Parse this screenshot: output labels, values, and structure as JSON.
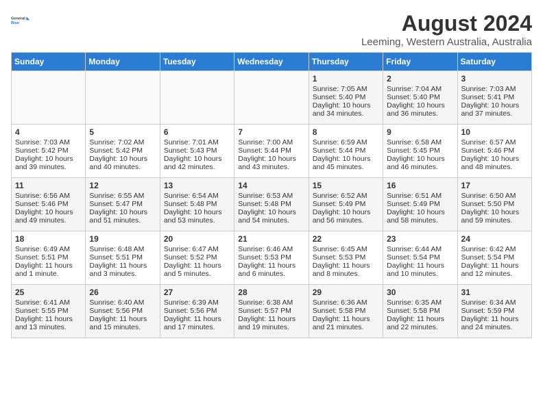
{
  "header": {
    "logo_line1": "General",
    "logo_line2": "Blue",
    "month_year": "August 2024",
    "location": "Leeming, Western Australia, Australia"
  },
  "days_of_week": [
    "Sunday",
    "Monday",
    "Tuesday",
    "Wednesday",
    "Thursday",
    "Friday",
    "Saturday"
  ],
  "weeks": [
    [
      {
        "day": "",
        "info": ""
      },
      {
        "day": "",
        "info": ""
      },
      {
        "day": "",
        "info": ""
      },
      {
        "day": "",
        "info": ""
      },
      {
        "day": "1",
        "info": "Sunrise: 7:05 AM\nSunset: 5:40 PM\nDaylight: 10 hours\nand 34 minutes."
      },
      {
        "day": "2",
        "info": "Sunrise: 7:04 AM\nSunset: 5:40 PM\nDaylight: 10 hours\nand 36 minutes."
      },
      {
        "day": "3",
        "info": "Sunrise: 7:03 AM\nSunset: 5:41 PM\nDaylight: 10 hours\nand 37 minutes."
      }
    ],
    [
      {
        "day": "4",
        "info": "Sunrise: 7:03 AM\nSunset: 5:42 PM\nDaylight: 10 hours\nand 39 minutes."
      },
      {
        "day": "5",
        "info": "Sunrise: 7:02 AM\nSunset: 5:42 PM\nDaylight: 10 hours\nand 40 minutes."
      },
      {
        "day": "6",
        "info": "Sunrise: 7:01 AM\nSunset: 5:43 PM\nDaylight: 10 hours\nand 42 minutes."
      },
      {
        "day": "7",
        "info": "Sunrise: 7:00 AM\nSunset: 5:44 PM\nDaylight: 10 hours\nand 43 minutes."
      },
      {
        "day": "8",
        "info": "Sunrise: 6:59 AM\nSunset: 5:44 PM\nDaylight: 10 hours\nand 45 minutes."
      },
      {
        "day": "9",
        "info": "Sunrise: 6:58 AM\nSunset: 5:45 PM\nDaylight: 10 hours\nand 46 minutes."
      },
      {
        "day": "10",
        "info": "Sunrise: 6:57 AM\nSunset: 5:46 PM\nDaylight: 10 hours\nand 48 minutes."
      }
    ],
    [
      {
        "day": "11",
        "info": "Sunrise: 6:56 AM\nSunset: 5:46 PM\nDaylight: 10 hours\nand 49 minutes."
      },
      {
        "day": "12",
        "info": "Sunrise: 6:55 AM\nSunset: 5:47 PM\nDaylight: 10 hours\nand 51 minutes."
      },
      {
        "day": "13",
        "info": "Sunrise: 6:54 AM\nSunset: 5:48 PM\nDaylight: 10 hours\nand 53 minutes."
      },
      {
        "day": "14",
        "info": "Sunrise: 6:53 AM\nSunset: 5:48 PM\nDaylight: 10 hours\nand 54 minutes."
      },
      {
        "day": "15",
        "info": "Sunrise: 6:52 AM\nSunset: 5:49 PM\nDaylight: 10 hours\nand 56 minutes."
      },
      {
        "day": "16",
        "info": "Sunrise: 6:51 AM\nSunset: 5:49 PM\nDaylight: 10 hours\nand 58 minutes."
      },
      {
        "day": "17",
        "info": "Sunrise: 6:50 AM\nSunset: 5:50 PM\nDaylight: 10 hours\nand 59 minutes."
      }
    ],
    [
      {
        "day": "18",
        "info": "Sunrise: 6:49 AM\nSunset: 5:51 PM\nDaylight: 11 hours\nand 1 minute."
      },
      {
        "day": "19",
        "info": "Sunrise: 6:48 AM\nSunset: 5:51 PM\nDaylight: 11 hours\nand 3 minutes."
      },
      {
        "day": "20",
        "info": "Sunrise: 6:47 AM\nSunset: 5:52 PM\nDaylight: 11 hours\nand 5 minutes."
      },
      {
        "day": "21",
        "info": "Sunrise: 6:46 AM\nSunset: 5:53 PM\nDaylight: 11 hours\nand 6 minutes."
      },
      {
        "day": "22",
        "info": "Sunrise: 6:45 AM\nSunset: 5:53 PM\nDaylight: 11 hours\nand 8 minutes."
      },
      {
        "day": "23",
        "info": "Sunrise: 6:44 AM\nSunset: 5:54 PM\nDaylight: 11 hours\nand 10 minutes."
      },
      {
        "day": "24",
        "info": "Sunrise: 6:42 AM\nSunset: 5:54 PM\nDaylight: 11 hours\nand 12 minutes."
      }
    ],
    [
      {
        "day": "25",
        "info": "Sunrise: 6:41 AM\nSunset: 5:55 PM\nDaylight: 11 hours\nand 13 minutes."
      },
      {
        "day": "26",
        "info": "Sunrise: 6:40 AM\nSunset: 5:56 PM\nDaylight: 11 hours\nand 15 minutes."
      },
      {
        "day": "27",
        "info": "Sunrise: 6:39 AM\nSunset: 5:56 PM\nDaylight: 11 hours\nand 17 minutes."
      },
      {
        "day": "28",
        "info": "Sunrise: 6:38 AM\nSunset: 5:57 PM\nDaylight: 11 hours\nand 19 minutes."
      },
      {
        "day": "29",
        "info": "Sunrise: 6:36 AM\nSunset: 5:58 PM\nDaylight: 11 hours\nand 21 minutes."
      },
      {
        "day": "30",
        "info": "Sunrise: 6:35 AM\nSunset: 5:58 PM\nDaylight: 11 hours\nand 22 minutes."
      },
      {
        "day": "31",
        "info": "Sunrise: 6:34 AM\nSunset: 5:59 PM\nDaylight: 11 hours\nand 24 minutes."
      }
    ]
  ]
}
